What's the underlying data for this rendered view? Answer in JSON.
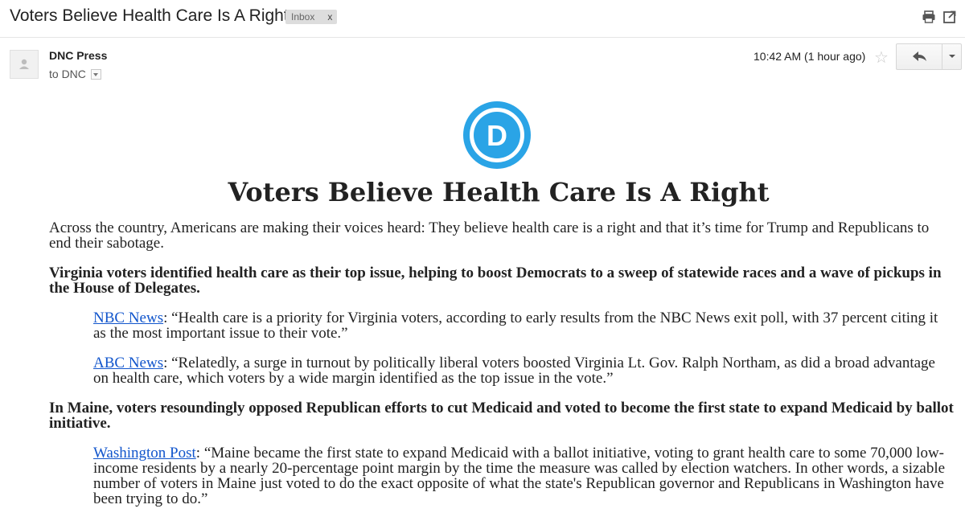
{
  "email": {
    "subject": "Voters Believe Health Care Is A Right",
    "label": "Inbox",
    "label_close": "x",
    "sender": "DNC Press",
    "recipient_line": "to DNC",
    "timestamp": "10:42 AM (1 hour ago)",
    "logo_letter": "D"
  },
  "icons": {
    "print": "print-icon",
    "popout": "new-window-icon",
    "star": "star-icon",
    "reply": "reply-icon",
    "more": "chevron-down-icon",
    "avatar": "person-icon"
  },
  "colors": {
    "dnc_blue": "#2aa4e6",
    "link": "#1155cc",
    "label_chip": "#dddddd"
  },
  "body": {
    "headline": "Voters Believe Health Care Is A Right",
    "intro": "Across the country, Americans are making their voices heard: They believe health care is a right and that it’s time for Trump and Republicans to end their sabotage.",
    "sections": [
      {
        "heading": "Virginia voters identified health care as their top issue, helping to boost Democrats to a sweep of statewide races and a wave of pickups in the House of Delegates.",
        "quotes": [
          {
            "source": "NBC News",
            "text": ": “Health care is a priority for Virginia voters, according to early results from the NBC News exit poll, with 37 percent citing it as the most important issue to their vote.”"
          },
          {
            "source": "ABC News",
            "text": ": “Relatedly, a surge in turnout by politically liberal voters boosted Virginia Lt. Gov. Ralph Northam, as did a broad advantage on health care, which voters by a wide margin identified as the top issue in the vote.”"
          }
        ]
      },
      {
        "heading": "In Maine, voters resoundingly opposed Republican efforts to cut Medicaid and voted to become the first state to expand Medicaid by ballot initiative.",
        "quotes": [
          {
            "source": "Washington Post",
            "text": ": “Maine became the first state to expand Medicaid with a ballot initiative, voting to grant health care to some 70,000 low-income residents by a nearly 20-percentage point margin by the time the measure was called by election watchers. In other words, a sizable number of voters in Maine just voted to do the exact opposite of what the state's Republican governor and Republicans in Washington have been trying to do.”"
          }
        ]
      }
    ]
  }
}
